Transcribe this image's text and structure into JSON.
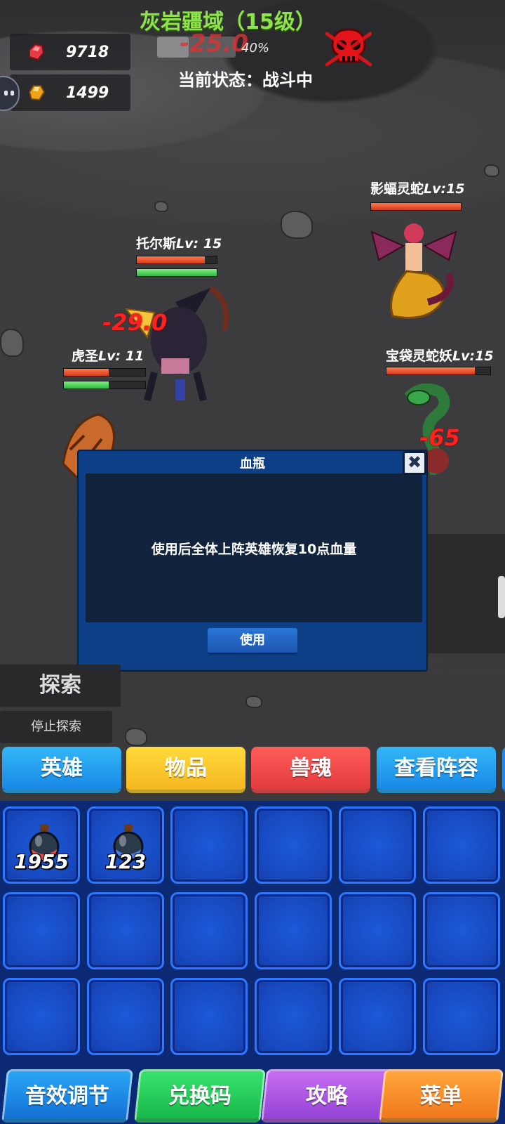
{
  "resources": {
    "red_gem": "9718",
    "gold_gem": "1499"
  },
  "zone": {
    "title": "灰岩疆域（15级）",
    "progress_value": 0.4,
    "progress_text": "40%",
    "floating_damage": "-25.0",
    "status": "当前状态：战斗中"
  },
  "units": {
    "tors": {
      "name": "托尔斯",
      "level": "Lv: 15",
      "hp": 0.85,
      "sp": 1.0,
      "damage": "-29.0"
    },
    "husheng": {
      "name": "虎圣",
      "level": "Lv: 11",
      "hp": 0.55,
      "sp": 0.55
    },
    "bat_snake": {
      "name": "影蝠灵蛇",
      "level": "Lv:15",
      "hp": 1.0
    },
    "bag_snake": {
      "name": "宝袋灵蛇妖",
      "level": "Lv:15",
      "hp": 0.85,
      "damage": "-65"
    }
  },
  "popup": {
    "title": "血瓶",
    "description": "使用后全体上阵英雄恢复10点血量",
    "use_label": "使用",
    "close_glyph": "✖"
  },
  "explore": {
    "label": "探索",
    "stop_label": "停止探索"
  },
  "tabs": {
    "hero": "英雄",
    "item": "物品",
    "soul": "兽魂",
    "team": "查看阵容"
  },
  "inventory": {
    "slots": [
      {
        "icon": "health-potion-icon",
        "count": "1955"
      },
      {
        "icon": "mana-potion-icon",
        "count": "123"
      }
    ]
  },
  "bottom_menu": {
    "sound": "音效调节",
    "code": "兑换码",
    "guide": "攻略",
    "menu": "菜单"
  },
  "colors": {
    "zone_title": "#8fe34a",
    "damage": "#ff2020",
    "tab_hero": "#1888e6",
    "tab_item": "#f5b820",
    "tab_soul": "#e23b3e",
    "inventory_bg": "#0c2a74"
  }
}
